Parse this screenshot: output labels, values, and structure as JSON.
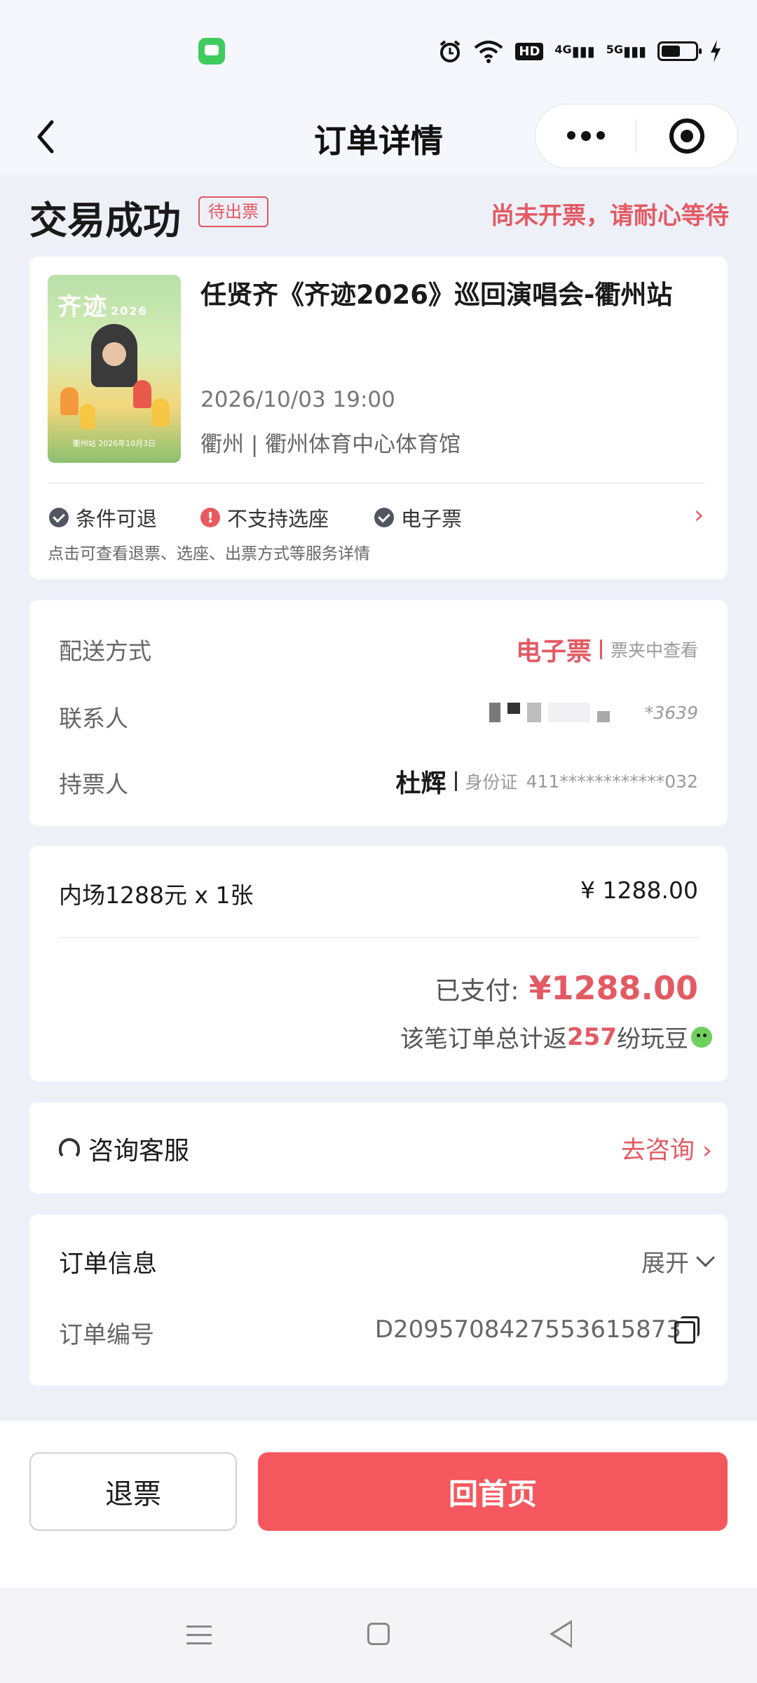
{
  "status_bar": {
    "icons": [
      "message-app-icon",
      "alarm-icon",
      "wifi-icon",
      "hd-icon",
      "signal-4g-icon",
      "signal-5g-icon",
      "battery-icon",
      "charging-icon"
    ],
    "hd_label": "HD",
    "net1": "4G",
    "net2": "5G"
  },
  "header": {
    "title": "订单详情",
    "back_icon": "chevron-left-icon",
    "more_icon": "more-dots-icon",
    "close_icon": "target-close-icon"
  },
  "order_status": {
    "title": "交易成功",
    "badge": "待出票",
    "note": "尚未开票，请耐心等待"
  },
  "event": {
    "name": "任贤齐《齐迹2026》巡回演唱会-衢州站",
    "time": "2026/10/03 19:00",
    "venue": "衢州 | 衢州体育中心体育馆",
    "poster": {
      "title": "齐迹",
      "year": "2026",
      "footer": "衢州站 2026年10月3日"
    },
    "features": [
      {
        "label": "条件可退",
        "icon": "check-circle-icon"
      },
      {
        "label": "不支持选座",
        "icon": "exclamation-circle-icon"
      },
      {
        "label": "电子票",
        "icon": "check-circle-icon"
      }
    ],
    "features_hint": "点击可查看退票、选座、出票方式等服务详情"
  },
  "delivery": {
    "method_label": "配送方式",
    "method_value": "电子票",
    "method_note": "票夹中查看",
    "contact_label": "联系人",
    "contact_phone": "*3639",
    "holder_label": "持票人",
    "holder_name": "杜辉",
    "holder_id_type": "身份证",
    "holder_id": "411************032"
  },
  "price": {
    "ticket_line": "内场1288元 x 1张",
    "ticket_price": "¥ 1288.00",
    "paid_label": "已支付:",
    "paid_amount": "¥1288.00",
    "cashback_prefix": "该笔订单总计返",
    "cashback_num": "257",
    "cashback_suffix": "纷玩豆"
  },
  "service": {
    "label": "咨询客服",
    "action": "去咨询 ›"
  },
  "order_info": {
    "title": "订单信息",
    "expand": "展开",
    "number_label": "订单编号",
    "number": "D2095708427553615873"
  },
  "bottom": {
    "refund": "退票",
    "home": "回首页"
  },
  "colors": {
    "accent": "#e35a63",
    "primary_button": "#f4585e",
    "background": "#eef0f8"
  }
}
